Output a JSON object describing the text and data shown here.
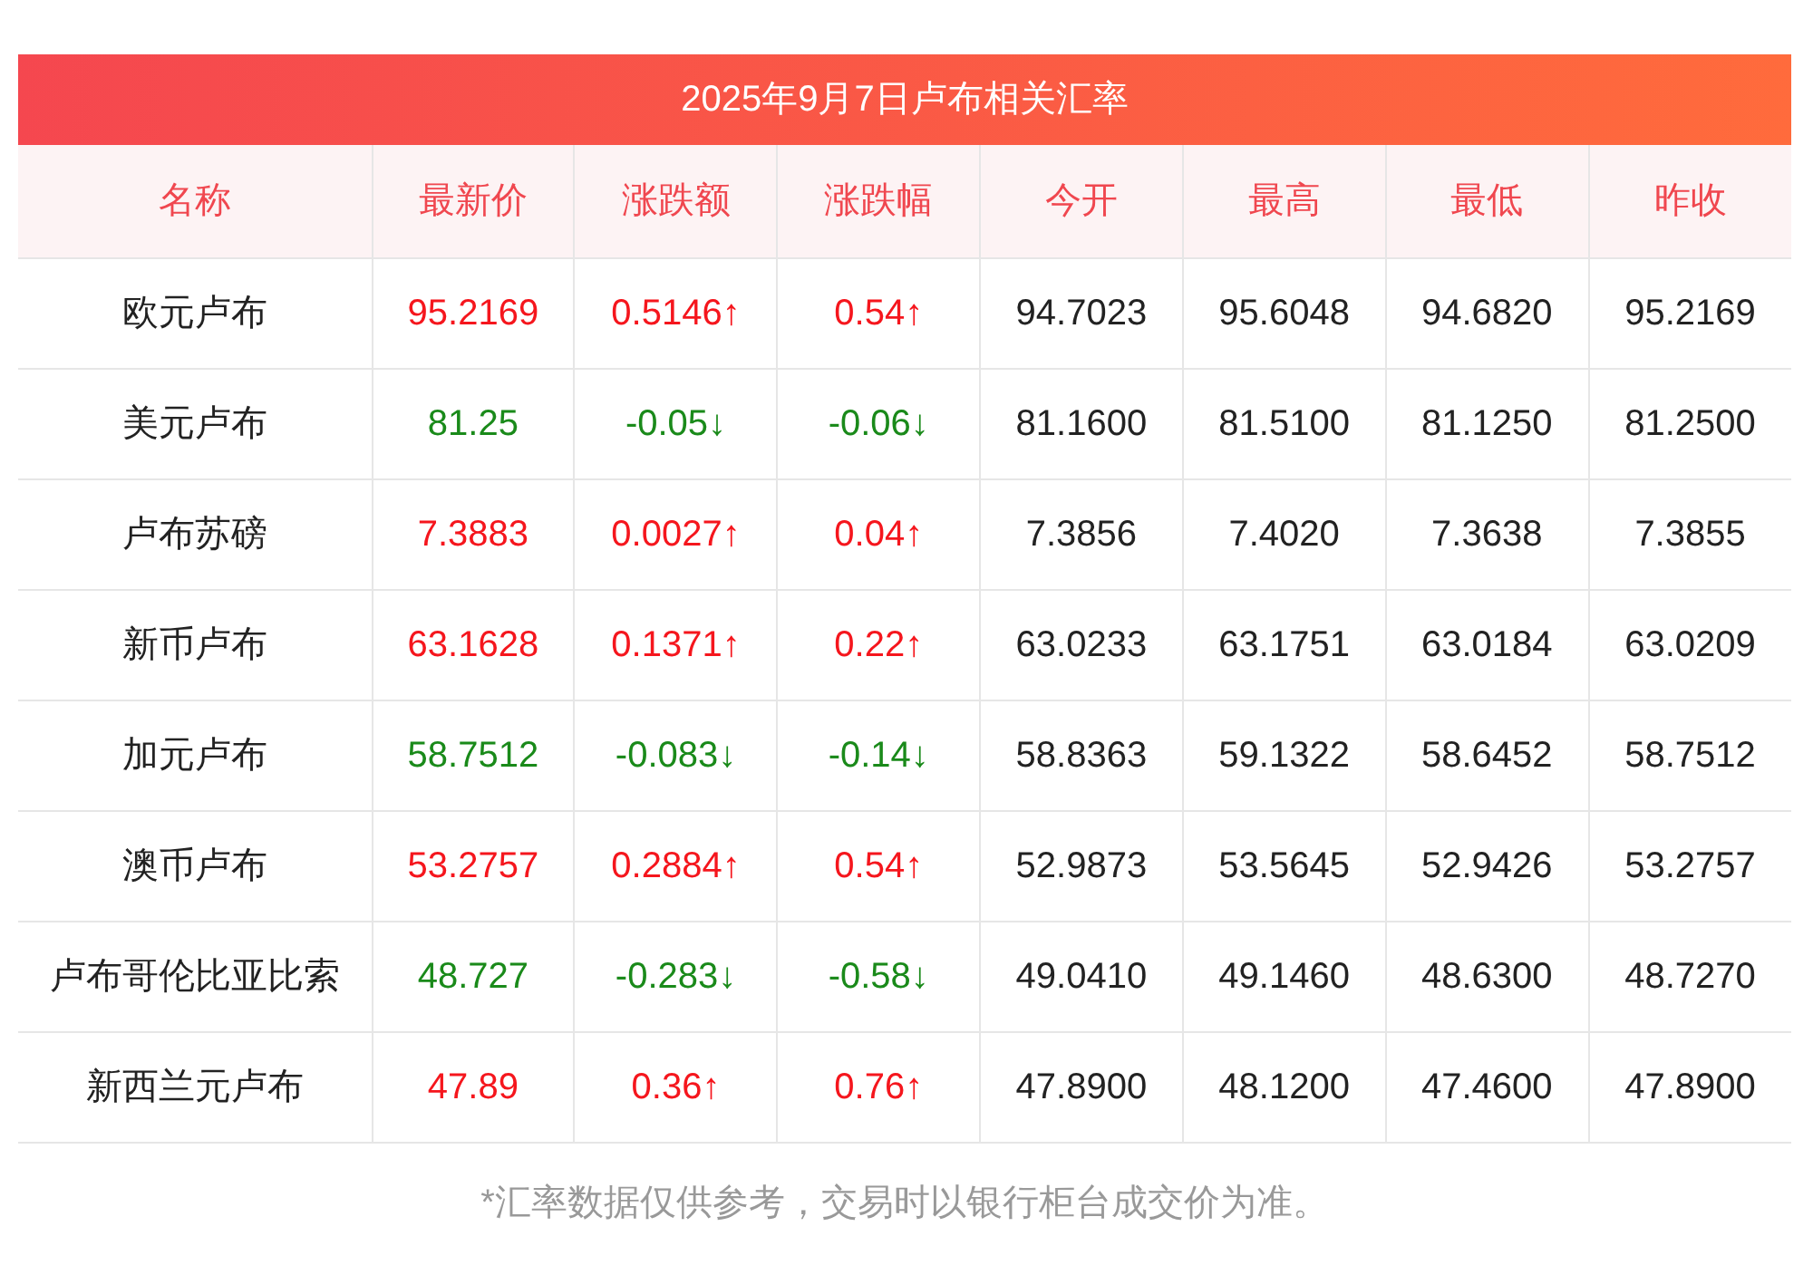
{
  "title": "2025年9月7日卢布相关汇率",
  "columns": [
    "名称",
    "最新价",
    "涨跌额",
    "涨跌幅",
    "今开",
    "最高",
    "最低",
    "昨收"
  ],
  "rows": [
    {
      "rising": true,
      "cells": [
        "欧元卢布",
        "95.2169",
        "0.5146↑",
        "0.54↑",
        "94.7023",
        "95.6048",
        "94.6820",
        "95.2169"
      ]
    },
    {
      "rising": false,
      "cells": [
        "美元卢布",
        "81.25",
        "-0.05↓",
        "-0.06↓",
        "81.1600",
        "81.5100",
        "81.1250",
        "81.2500"
      ]
    },
    {
      "rising": true,
      "cells": [
        "卢布苏磅",
        "7.3883",
        "0.0027↑",
        "0.04↑",
        "7.3856",
        "7.4020",
        "7.3638",
        "7.3855"
      ]
    },
    {
      "rising": true,
      "cells": [
        "新币卢布",
        "63.1628",
        "0.1371↑",
        "0.22↑",
        "63.0233",
        "63.1751",
        "63.0184",
        "63.0209"
      ]
    },
    {
      "rising": false,
      "cells": [
        "加元卢布",
        "58.7512",
        "-0.083↓",
        "-0.14↓",
        "58.8363",
        "59.1322",
        "58.6452",
        "58.7512"
      ]
    },
    {
      "rising": true,
      "cells": [
        "澳币卢布",
        "53.2757",
        "0.2884↑",
        "0.54↑",
        "52.9873",
        "53.5645",
        "52.9426",
        "53.2757"
      ]
    },
    {
      "rising": false,
      "cells": [
        "卢布哥伦比亚比索",
        "48.727",
        "-0.283↓",
        "-0.58↓",
        "49.0410",
        "49.1460",
        "48.6300",
        "48.7270"
      ]
    },
    {
      "rising": true,
      "cells": [
        "新西兰元卢布",
        "47.89",
        "0.36↑",
        "0.76↑",
        "47.8900",
        "48.1200",
        "47.4600",
        "47.8900"
      ]
    }
  ],
  "note": "*汇率数据仅供参考，交易时以银行柜台成交价为准。"
}
